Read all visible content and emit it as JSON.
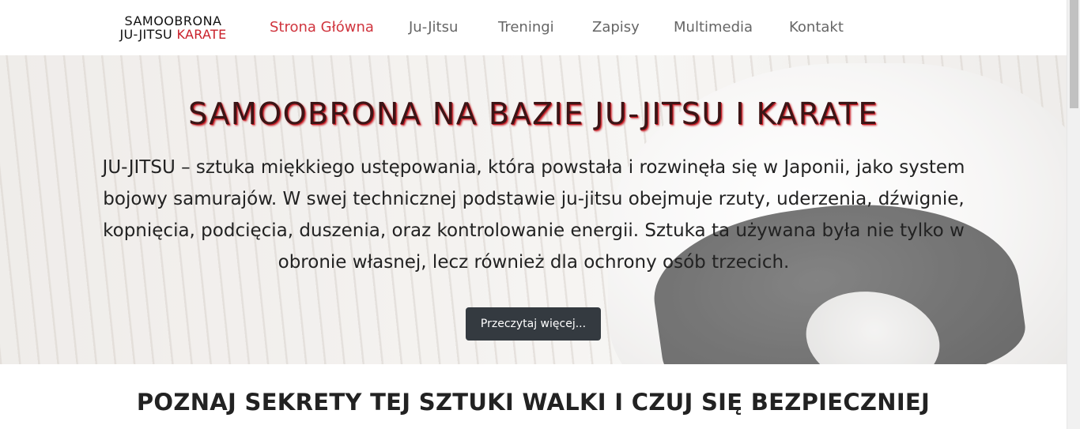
{
  "logo": {
    "line1": "SAMOOBRONA",
    "line2_black": "JU-JITSU",
    "line2_red": "KARATE"
  },
  "nav": {
    "items": [
      {
        "label": "Strona Główna",
        "active": true
      },
      {
        "label": "Ju-Jitsu",
        "active": false
      },
      {
        "label": "Treningi",
        "active": false
      },
      {
        "label": "Zapisy",
        "active": false
      },
      {
        "label": "Multimedia",
        "active": false
      },
      {
        "label": "Kontakt",
        "active": false
      }
    ]
  },
  "hero": {
    "title": "SAMOOBRONA NA BAZIE JU-JITSU I KARATE",
    "text": "JU-JITSU – sztuka miękkiego ustępowania, która powstała i rozwinęła się w Japonii, jako system bojowy samurajów. W swej technicznej podstawie ju-jitsu obejmuje rzuty, uderzenia, dźwignie, kopnięcia, podcięcia, duszenia, oraz kontrolowanie energii. Sztuka ta używana była nie tylko w obronie własnej, lecz również dla ochrony osób trzecich.",
    "button_label": "Przeczytaj więcej..."
  },
  "section": {
    "title": "POZNAJ SEKRETY TEJ SZTUKI WALKI I CZUJ SIĘ BEZPIECZNIEJ"
  },
  "colors": {
    "accent": "#d0353e",
    "logo_red": "#c9202a",
    "button_bg": "#343a40",
    "nav_text": "#666666"
  }
}
